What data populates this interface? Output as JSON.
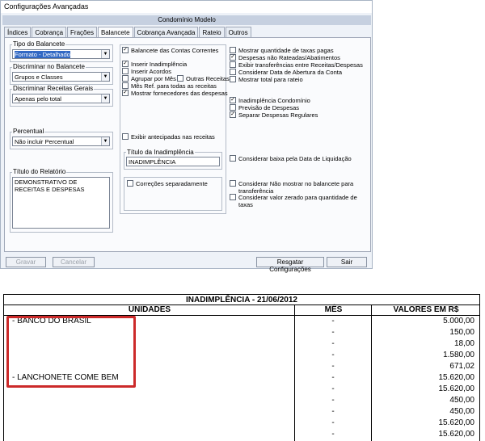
{
  "window": {
    "title": "Configurações Avançadas",
    "subtitle": "Condomínio Modelo"
  },
  "tabs": [
    {
      "label": "Índices",
      "active": false
    },
    {
      "label": "Cobrança",
      "active": false
    },
    {
      "label": "Frações",
      "active": false
    },
    {
      "label": "Balancete",
      "active": true
    },
    {
      "label": "Cobrança Avançada",
      "active": false
    },
    {
      "label": "Rateio",
      "active": false
    },
    {
      "label": "Outros",
      "active": false
    }
  ],
  "left": {
    "tipo_label": "Tipo do Balancete",
    "tipo_value": "Formato - Detalhado",
    "discriminar_label": "Discriminar no Balancete",
    "discriminar_value": "Grupos e Classes",
    "receitas_label": "Discriminar Receitas Gerais",
    "receitas_value": "Apenas pelo total",
    "percentual_label": "Percentual",
    "percentual_value": "Não incluir Percentual",
    "titulo_label": "Título do Relatório",
    "titulo_value": "DEMONSTRATIVO DE RECEITAS E DESPESAS"
  },
  "middle": {
    "chk_balancete_contas": {
      "label": "Balancete das Contas Correntes",
      "checked": true
    },
    "chk_inserir_inad": {
      "label": "Inserir Inadimplência",
      "checked": true
    },
    "chk_inserir_acordos": {
      "label": "Inserir Acordos",
      "checked": false
    },
    "chk_agrupar_mes": {
      "label": "Agrupar por Mês",
      "checked": false
    },
    "chk_outras_receitas": {
      "label": "Outras Receitas",
      "checked": false
    },
    "chk_mes_ref": {
      "label": "Mês Ref. para todas as receitas",
      "checked": false
    },
    "chk_mostrar_fornecedores": {
      "label": "Mostrar fornecedores das despesas",
      "checked": true
    },
    "chk_exibir_antecipadas": {
      "label": "Exibir antecipadas nas receitas",
      "checked": false
    },
    "titulo_inad_label": "Título da Inadimplência",
    "titulo_inad_value": "INADIMPLÊNCIA",
    "chk_correcoes": {
      "label": "Correções separadamente",
      "checked": false
    }
  },
  "right": {
    "chk_mostrar_qtd": {
      "label": "Mostrar quantidade de taxas pagas",
      "checked": false
    },
    "chk_despesas_nao_rateadas": {
      "label": "Despesas não Rateadas/Abatimentos",
      "checked": true
    },
    "chk_exibir_transf": {
      "label": "Exibir transferências entre Receitas/Despesas",
      "checked": false
    },
    "chk_considerar_abertura": {
      "label": "Considerar Data de Abertura da Conta",
      "checked": false
    },
    "chk_mostrar_total": {
      "label": "Mostrar total para rateio",
      "checked": false
    },
    "chk_inad_condominio": {
      "label": "Inadimplência Condomínio",
      "checked": true
    },
    "chk_previsao": {
      "label": "Previsão de Despesas",
      "checked": false
    },
    "chk_separar": {
      "label": "Separar Despesas Regulares",
      "checked": true
    },
    "chk_baixa": {
      "label": "Considerar baixa pela Data de Liquidação",
      "checked": false
    },
    "chk_nao_mostrar_transf": {
      "label": "Considerar Não mostrar no balancete para transferência",
      "checked": false
    },
    "chk_valor_zerado": {
      "label": "Considerar valor zerado para quantidade de taxas",
      "checked": false
    }
  },
  "buttons": {
    "gravar": "Gravar",
    "cancelar": "Cancelar",
    "resgatar": "Resgatar Configurações",
    "sair": "Sair"
  },
  "report": {
    "title": "INADIMPLÊNCIA - 21/06/2012",
    "col_unidades": "UNIDADES",
    "col_mes": "MÊS",
    "col_valores": "VALORES EM R$",
    "rows": [
      {
        "unidade": "- BANCO DO BRASIL",
        "mes": "-",
        "valor": "5.000,00"
      },
      {
        "unidade": "",
        "mes": "-",
        "valor": "150,00"
      },
      {
        "unidade": "",
        "mes": "-",
        "valor": "18,00"
      },
      {
        "unidade": "",
        "mes": "-",
        "valor": "1.580,00"
      },
      {
        "unidade": "",
        "mes": "-",
        "valor": "671,02"
      },
      {
        "unidade": "- LANCHONETE COME BEM",
        "mes": "-",
        "valor": "15.620,00"
      },
      {
        "unidade": "",
        "mes": "-",
        "valor": "15.620,00"
      },
      {
        "unidade": "",
        "mes": "-",
        "valor": "450,00"
      },
      {
        "unidade": "",
        "mes": "-",
        "valor": "450,00"
      },
      {
        "unidade": "",
        "mes": "-",
        "valor": "15.620,00"
      },
      {
        "unidade": "",
        "mes": "-",
        "valor": "15.620,00"
      }
    ]
  }
}
